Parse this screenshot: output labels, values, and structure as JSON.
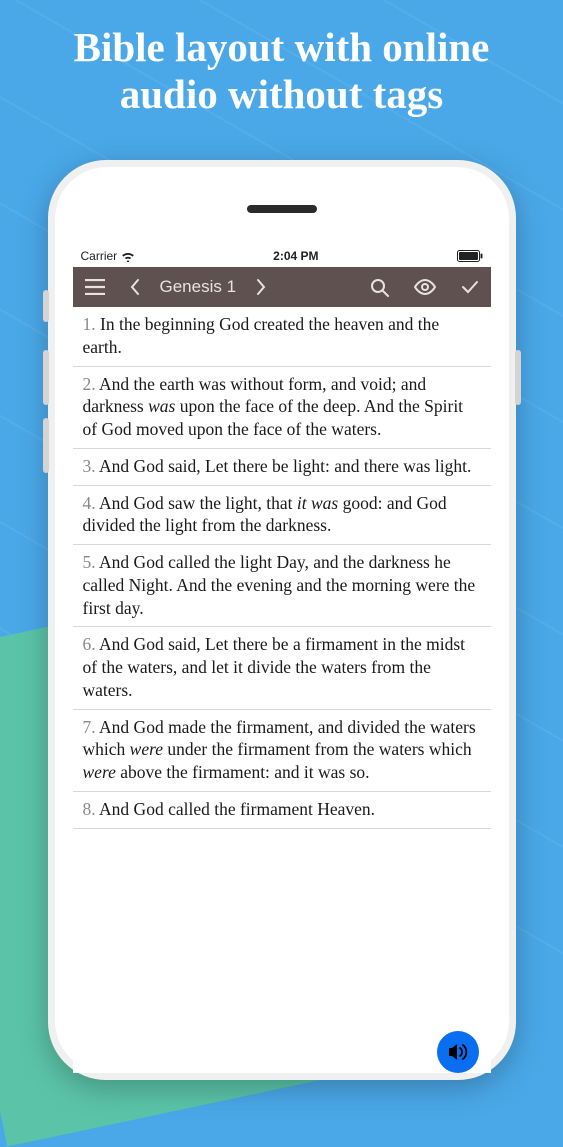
{
  "promo": {
    "title_line1": "Bible layout with online",
    "title_line2": "audio without tags"
  },
  "statusBar": {
    "carrier": "Carrier",
    "time": "2:04 PM"
  },
  "navBar": {
    "title": "Genesis 1"
  },
  "verses": [
    {
      "num": "1.",
      "html": "In the beginning God created the heaven and the earth."
    },
    {
      "num": "2.",
      "html": "And the earth was without form, and void; and darkness <em>was</em> upon the face of the deep. And the Spirit of God moved upon the face of the waters."
    },
    {
      "num": "3.",
      "html": "And God said, Let there be light: and there was light."
    },
    {
      "num": "4.",
      "html": "And God saw the light, that <em>it was</em> good: and God divided the light from the darkness."
    },
    {
      "num": "5.",
      "html": "And God called the light Day, and the darkness he called Night. And the evening and the morning were the first day."
    },
    {
      "num": "6.",
      "html": "And God said, Let there be a firmament in the midst of the waters, and let it divide the waters from the waters."
    },
    {
      "num": "7.",
      "html": "And God made the firmament, and divided the waters which <em>were</em> under the firmament from the waters which <em>were</em> above the firmament: and it was so."
    },
    {
      "num": "8.",
      "html": "And God called the firmament Heaven."
    }
  ]
}
